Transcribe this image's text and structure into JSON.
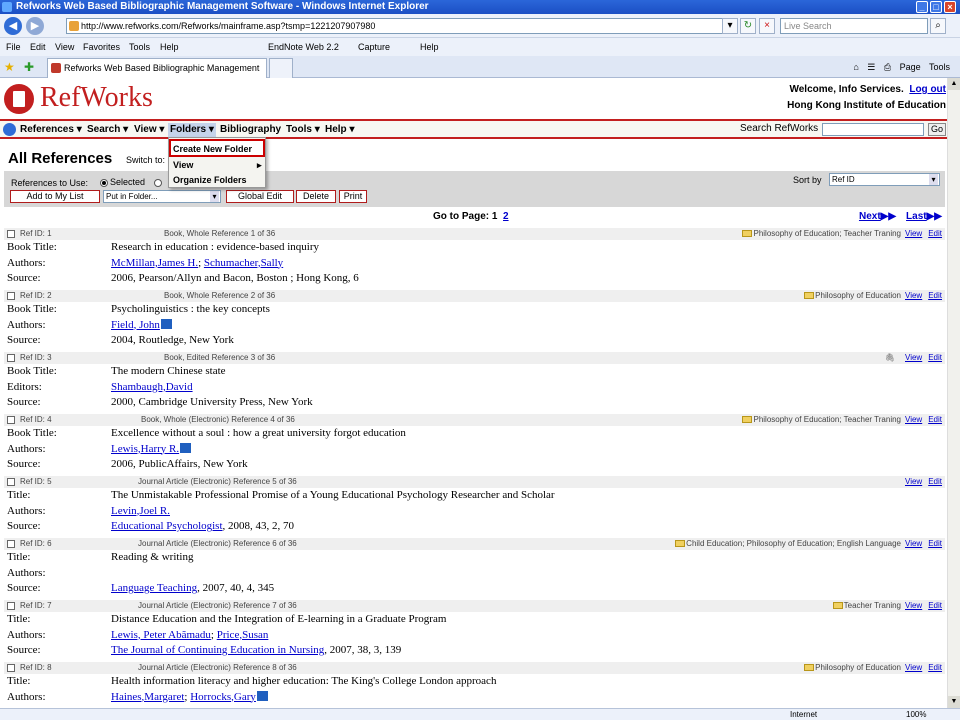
{
  "browser": {
    "title": "Refworks Web Based Bibliographic Management Software - Windows Internet Explorer",
    "url": "http://www.refworks.com/Refworks/mainframe.asp?tsmp=1221207907980",
    "search_placeholder": "Live Search",
    "menus": [
      "File",
      "Edit",
      "View",
      "Favorites",
      "Tools",
      "Help"
    ],
    "links": [
      "EndNote Web 2.2",
      "Capture",
      "Help"
    ],
    "tab_label": "Refworks Web Based Bibliographic Management Soft...",
    "tools_right": [
      "Page",
      "Tools"
    ],
    "status_internet": "Internet",
    "status_zoom": "100%"
  },
  "refworks": {
    "logo": "RefWorks",
    "welcome": "Welcome, Info Services.",
    "logout": "Log out",
    "institution": "Hong Kong Institute of Education",
    "nav": [
      "References",
      "Search",
      "View",
      "Folders",
      "Bibliography",
      "Tools",
      "Help"
    ],
    "search_label": "Search RefWorks",
    "go": "Go",
    "page_title": "All References",
    "switch_to": "Switch to:",
    "refs_to_use": "References to Use:",
    "selected": "Selected",
    "sort_by": "Sort by",
    "sort_value": "Ref ID",
    "add_to_list": "Add to My List",
    "put_in_folder": "Put in Folder...",
    "global_edit": "Global Edit",
    "delete": "Delete",
    "print": "Print",
    "goto_page": "Go to Page: 1",
    "page2": "2",
    "next": "Next",
    "last": "Last",
    "dropdown": [
      "Create New Folder",
      "View",
      "Organize Folders"
    ],
    "view": "View",
    "edit": "Edit"
  },
  "references": [
    {
      "id": "Ref ID: 1",
      "type": "Book, Whole Reference 1 of 36",
      "folder": "Philosophy of Education; Teacher Traning",
      "lines": [
        [
          "Book Title:",
          "Research in education : evidence-based inquiry"
        ],
        [
          "Authors:",
          ""
        ],
        [
          "Source:",
          "2006, Pearson/Allyn and Bacon, Boston ; Hong Kong, 6"
        ]
      ],
      "authors": [
        "McMillan,James H.",
        "Schumacher,Sally"
      ]
    },
    {
      "id": "Ref ID: 2",
      "type": "Book, Whole Reference 2 of 36",
      "folder": "Philosophy of Education",
      "lines": [
        [
          "Book Title:",
          "Psycholinguistics : the key concepts"
        ],
        [
          "Authors:",
          ""
        ],
        [
          "Source:",
          "2004, Routledge, New York"
        ]
      ],
      "authors": [
        "Field, John"
      ]
    },
    {
      "id": "Ref ID: 3",
      "type": "Book, Edited Reference 3 of 36",
      "folder": "",
      "lines": [
        [
          "Book Title:",
          "The modern Chinese state"
        ],
        [
          "Editors:",
          ""
        ],
        [
          "Source:",
          "2000, Cambridge University Press, New York"
        ]
      ],
      "authors": [
        "Shambaugh,David"
      ]
    },
    {
      "id": "Ref ID: 4",
      "type": "Book, Whole (Electronic) Reference 4 of 36",
      "folder": "Philosophy of Education; Teacher Traning",
      "lines": [
        [
          "Book Title:",
          "Excellence without a soul : how a great university forgot education"
        ],
        [
          "Authors:",
          ""
        ],
        [
          "Source:",
          "2006, PublicAffairs, New York"
        ]
      ],
      "authors": [
        "Lewis,Harry R."
      ]
    },
    {
      "id": "Ref ID: 5",
      "type": "Journal Article (Electronic) Reference 5 of 36",
      "folder": "",
      "lines": [
        [
          "Title:",
          "The Unmistakable Professional Promise of a Young Educational Psychology Researcher and Scholar"
        ],
        [
          "Authors:",
          ""
        ],
        [
          "Source:",
          ""
        ]
      ],
      "authors": [
        "Levin,Joel R."
      ],
      "source_link": "Educational Psychologist",
      "source_rest": ", 2008, 43, 2, 70"
    },
    {
      "id": "Ref ID: 6",
      "type": "Journal Article (Electronic) Reference 6 of 36",
      "folder": "Child Education; Philosophy of Education; English Language",
      "lines": [
        [
          "Title:",
          "Reading & writing"
        ],
        [
          "Authors:",
          ""
        ],
        [
          "Source:",
          ""
        ]
      ],
      "authors": [],
      "source_link": "Language Teaching",
      "source_rest": ", 2007, 40, 4, 345"
    },
    {
      "id": "Ref ID: 7",
      "type": "Journal Article (Electronic) Reference 7 of 36",
      "folder": "Teacher Traning",
      "lines": [
        [
          "Title:",
          "Distance Education and the Integration of E-learning in a Graduate Program"
        ],
        [
          "Authors:",
          ""
        ],
        [
          "Source:",
          ""
        ]
      ],
      "authors": [
        "Lewis, Peter Abãmadu",
        "Price,Susan"
      ],
      "source_link": "The Journal of Continuing Education in Nursing",
      "source_rest": ", 2007, 38, 3, 139"
    },
    {
      "id": "Ref ID: 8",
      "type": "Journal Article (Electronic) Reference 8 of 36",
      "folder": "Philosophy of Education",
      "lines": [
        [
          "Title:",
          "Health information literacy and higher education: The King's College London approach"
        ],
        [
          "Authors:",
          ""
        ]
      ],
      "authors": [
        "Haines,Margaret",
        "Horrocks,Gary"
      ]
    }
  ]
}
